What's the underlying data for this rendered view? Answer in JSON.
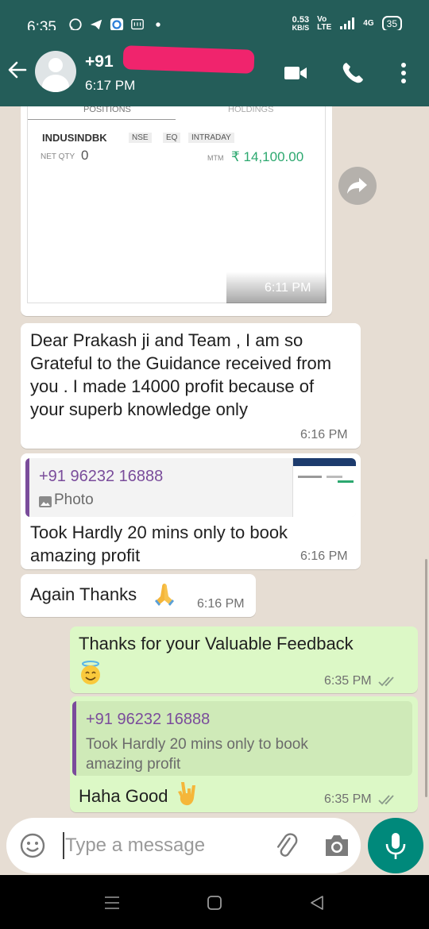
{
  "status_bar": {
    "time": "6:35",
    "speed_value": "0.53",
    "speed_unit": "KB/S",
    "net_top": "Vo",
    "net_bottom": "LTE",
    "net_4g": "4G",
    "battery": "35"
  },
  "header": {
    "contact_name": "+91",
    "last_seen": "6:17 PM"
  },
  "screenshot_card": {
    "tab_positions": "POSITIONS",
    "tab_holdings": "HOLDINGS",
    "symbol": "INDUSINDBK",
    "exchange": "NSE",
    "segment": "EQ",
    "product": "INTRADAY",
    "net_qty_label": "NET QTY",
    "net_qty": "0",
    "mtm_label": "MTM",
    "mtm_value": "₹ 14,100.00",
    "time": "6:11 PM"
  },
  "messages": [
    {
      "text": "Dear Prakash ji and Team , I am so Grateful to the Guidance received from you . I made 14000 profit because of your superb knowledge only",
      "time": "6:16 PM"
    },
    {
      "quote_name": "+91 96232 16888",
      "quote_text": "Photo",
      "text": "Took Hardly 20 mins only to book amazing profit",
      "time": "6:16 PM"
    },
    {
      "text": "Again Thanks",
      "time": "6:16 PM"
    },
    {
      "text": "Thanks for your Valuable Feedback",
      "time": "6:35 PM"
    },
    {
      "quote_name": "+91 96232 16888",
      "quote_text": "Took Hardly 20 mins only to book amazing profit",
      "text": "Haha Good",
      "time": "6:35 PM"
    }
  ],
  "input": {
    "placeholder": "Type a message"
  },
  "colors": {
    "header": "#245d59",
    "chat_bg": "#e6ddd3",
    "outgoing": "#dcf8c6",
    "accent": "#00897b",
    "quote_name": "#7a4c9b",
    "mtm_green": "#2ca86f"
  }
}
